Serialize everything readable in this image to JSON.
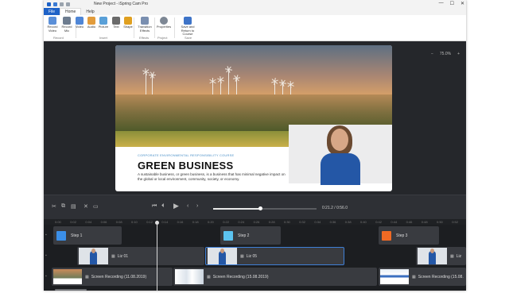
{
  "window": {
    "title": "New Project - iSpring Cam Pro",
    "controls": [
      "—",
      "☐",
      "✕"
    ]
  },
  "ribbon": {
    "file_tab": "File",
    "tabs": [
      "Home",
      "Help"
    ],
    "buttons": [
      {
        "label": "Record Video",
        "icon": "record-video-icon",
        "color": "#5a8fd8"
      },
      {
        "label": "Record Mic",
        "icon": "record-mic-icon",
        "color": "#6d7c8f"
      },
      {
        "label": "Video",
        "icon": "video-icon",
        "color": "#4f86d6"
      },
      {
        "label": "Audio",
        "icon": "audio-icon",
        "color": "#e29c3c"
      },
      {
        "label": "Picture",
        "icon": "picture-icon",
        "color": "#5aa0d8"
      },
      {
        "label": "Text",
        "icon": "text-icon",
        "color": "#6a6a6a"
      },
      {
        "label": "Shape",
        "icon": "shape-icon",
        "color": "#e0a020"
      },
      {
        "label": "Transition Effects",
        "icon": "transition-effects-icon",
        "color": "#7a8fb0"
      },
      {
        "label": "Properties",
        "icon": "properties-gear-icon",
        "color": "#7d8794"
      },
      {
        "label": "Save and Return to Course",
        "icon": "save-return-icon",
        "color": "#3e74c8"
      }
    ],
    "groups": [
      "Record",
      "Insert",
      "Effects",
      "Project",
      "Save"
    ]
  },
  "canvas": {
    "zoom_level": "75.0%",
    "zoom_minus": "−",
    "zoom_plus": "+"
  },
  "slide": {
    "tagline": "CORPORATE ENVIRONMENTAL RESPONSIBILITY COURSE",
    "headline": "GREEN BUSINESS",
    "body": "A sustainable business, or green business, is a business that has minimal negative impact on the global or local environment, community, society, or economy."
  },
  "player": {
    "timecode": "0:21.2 / 0:56.0",
    "progress_fraction": 0.45
  },
  "timeline": {
    "ruler_ticks": [
      "0:00",
      "0:02",
      "0:04",
      "0:06",
      "0:08",
      "0:10",
      "0:12",
      "0:14",
      "0:16",
      "0:18",
      "0:20",
      "0:22",
      "0:24",
      "0:26",
      "0:28",
      "0:30",
      "0:32",
      "0:34",
      "0:36",
      "0:38",
      "0:40",
      "0:42",
      "0:44",
      "0:46",
      "0:48",
      "0:50",
      "0:52"
    ],
    "steps": [
      {
        "label": "Step 1",
        "color": "#3b8fe8"
      },
      {
        "label": "Step 2",
        "color": "#5cc3f0"
      },
      {
        "label": "Step 3",
        "color": "#f06a24"
      }
    ],
    "video_clips": [
      "Liz 01",
      "Liz 05",
      "Liz"
    ],
    "recordings": [
      "Screen Recording (11.08.2019)",
      "Screen Recording (15.08.2019)",
      "Screen Recording (15.08."
    ]
  }
}
